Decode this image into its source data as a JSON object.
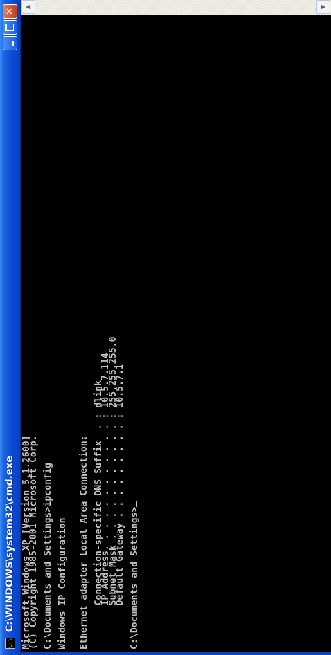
{
  "window": {
    "title": "C:\\WINDOWS\\system32\\cmd.exe",
    "icon_text": "C:\\"
  },
  "icons": {
    "system": "console-app-icon",
    "minimize": "minimize-icon",
    "maximize": "maximize-icon",
    "close": "close-icon",
    "scroll_up": "arrow-up-icon",
    "scroll_down": "arrow-down-icon"
  },
  "console": {
    "lines": [
      "Microsoft Windows XP [Version 5.1.2600]",
      "(C) Copyright 1985-2001 Microsoft Corp.",
      "",
      "C:\\Documents and Settings>ipconfig",
      "",
      "Windows IP Configuration",
      "",
      "",
      "Ethernet adapter Local Area Connection:",
      "",
      "        Connection-specific DNS Suffix  . : dlink",
      "        IP Address. . . . . . . . . . . . : 10.5.7.114",
      "        Subnet Mask . . . . . . . . . . . : 255.255.255.0",
      "        Default Gateway . . . . . . . . . : 10.5.7.1",
      "",
      "C:\\Documents and Settings>"
    ]
  },
  "colors": {
    "titlebar": "#0a4ed6",
    "console_bg": "#000000",
    "console_text": "#c0c0c0"
  }
}
